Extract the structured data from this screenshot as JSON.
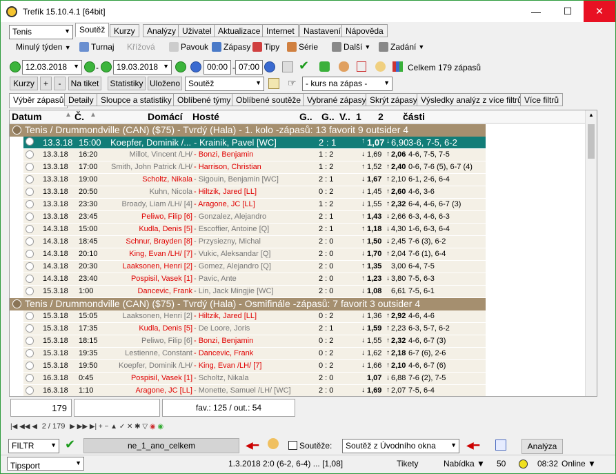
{
  "window": {
    "title": "Trefík 15.10.4.1 [64bit]",
    "min": "—",
    "max": "☐",
    "close": "✕"
  },
  "left_panel": {
    "sport": "Tenis",
    "period": "Minulý týden"
  },
  "menu_tabs": [
    "Soutěž",
    "Kurzy",
    "Analýzy",
    "Uživatel",
    "Aktualizace",
    "Internet",
    "Nastavení",
    "Nápověda"
  ],
  "toolbar": {
    "turnaj": "Turnaj",
    "krizova": "Křížová",
    "pavouk": "Pavouk",
    "zapasy": "Zápasy",
    "tipy": "Tipy",
    "serie": "Série",
    "dalsi": "Další",
    "zadani": "Zadání"
  },
  "filterbar": {
    "date_from": "12.03.2018",
    "date_to": "19.03.2018",
    "time_from": "00:00",
    "time_to": "07:00",
    "total": "Celkem 179 zápasů",
    "kurzy": "Kurzy",
    "plus": "+",
    "minus": "-",
    "na_tiket": "Na tiket",
    "statistiky": "Statistiky",
    "ulozeno": "Uloženo",
    "soutez": "Soutěž",
    "kurs": "- kurs na zápas -"
  },
  "subtabs": [
    "Výběr zápasů",
    "Detaily",
    "Sloupce a statistiky",
    "Oblíbené týmy",
    "Oblíbené soutěže",
    "Vybrané zápasy",
    "Skrýt zápasy",
    "Výsledky analýz z více filtrů",
    "Více filtrů"
  ],
  "columns": [
    "Datum",
    "Č.",
    "Domácí",
    "Hosté",
    "G..",
    "G..",
    "V..",
    "1",
    "2",
    "části"
  ],
  "groups": [
    {
      "title": "Tenis / Drummondville (CAN)  ($75) - Tvrdý (Hala) - 1. kolo -zápasů: 13      favorit 9  outsider 4",
      "rows": [
        {
          "date": "13.3.18",
          "time": "15:00",
          "home": "Koepfer, Dominik /...",
          "away": "- Krainik, Pavel [WC]",
          "score": "2 : 1",
          "o1": "1,07",
          "o2": "6,90",
          "sets": "3-6, 7-5, 6-2",
          "fav": "none",
          "o1b": true,
          "o2b": false,
          "a1": "↑",
          "a2": "↓",
          "sel": true
        },
        {
          "date": "13.3.18",
          "time": "16:20",
          "home": "Millot, Vincent /LH/",
          "away": "- Bonzi, Benjamin",
          "score": "1 : 2",
          "o1": "1,69",
          "o2": "2,06",
          "sets": "4-6, 7-5, 7-5",
          "fav": "away",
          "o1b": false,
          "o2b": true,
          "a1": "↓",
          "a2": "↑"
        },
        {
          "date": "13.3.18",
          "time": "17:00",
          "home": "Smith, John Patrick /LH/",
          "away": "- Harrison, Christian",
          "score": "1 : 2",
          "o1": "1,52",
          "o2": "2,40",
          "sets": "0-6, 7-6 (5), 6-7 (4)",
          "fav": "away",
          "o1b": false,
          "o2b": true,
          "a1": "↑",
          "a2": "↑"
        },
        {
          "date": "13.3.18",
          "time": "19:00",
          "home": "Scholtz, Nikala",
          "away": "- Sigouin, Benjamin [WC]",
          "score": "2 : 1",
          "o1": "1,67",
          "o2": "2,10",
          "sets": "6-1, 2-6, 6-4",
          "fav": "home",
          "o1b": true,
          "o2b": false,
          "a1": "↓",
          "a2": "↑"
        },
        {
          "date": "13.3.18",
          "time": "20:50",
          "home": "Kuhn, Nicola",
          "away": "- Hiltzik, Jared [LL]",
          "score": "0 : 2",
          "o1": "1,45",
          "o2": "2,60",
          "sets": "4-6, 3-6",
          "fav": "away",
          "o1b": false,
          "o2b": true,
          "a1": "↓",
          "a2": "↑"
        },
        {
          "date": "13.3.18",
          "time": "23:30",
          "home": "Broady, Liam /LH/ [4]",
          "away": "- Aragone, JC [LL]",
          "score": "1 : 2",
          "o1": "1,55",
          "o2": "2,32",
          "sets": "6-4, 4-6, 6-7 (3)",
          "fav": "away",
          "o1b": false,
          "o2b": true,
          "a1": "↓",
          "a2": "↑"
        },
        {
          "date": "13.3.18",
          "time": "23:45",
          "home": "Peliwo, Filip [6]",
          "away": "- Gonzalez, Alejandro",
          "score": "2 : 1",
          "o1": "1,43",
          "o2": "2,66",
          "sets": "6-3, 4-6, 6-3",
          "fav": "home",
          "o1b": true,
          "o2b": false,
          "a1": "↑",
          "a2": "↓"
        },
        {
          "date": "14.3.18",
          "time": "15:00",
          "home": "Kudla, Denis [5]",
          "away": "- Escoffier, Antoine [Q]",
          "score": "2 : 1",
          "o1": "1,18",
          "o2": "4,30",
          "sets": "1-6, 6-3, 6-4",
          "fav": "home",
          "o1b": true,
          "o2b": false,
          "a1": "↑",
          "a2": "↓"
        },
        {
          "date": "14.3.18",
          "time": "18:45",
          "home": "Schnur, Brayden [8]",
          "away": "- Przysiezny, Michal",
          "score": "2 : 0",
          "o1": "1,50",
          "o2": "2,45",
          "sets": "7-6 (3), 6-2",
          "fav": "home",
          "o1b": true,
          "o2b": false,
          "a1": "↑",
          "a2": "↓"
        },
        {
          "date": "14.3.18",
          "time": "20:10",
          "home": "King, Evan /LH/ [7]",
          "away": "- Vukic, Aleksandar [Q]",
          "score": "2 : 0",
          "o1": "1,70",
          "o2": "2,04",
          "sets": "7-6 (1), 6-4",
          "fav": "home",
          "o1b": true,
          "o2b": false,
          "a1": "↓",
          "a2": "↑"
        },
        {
          "date": "14.3.18",
          "time": "20:30",
          "home": "Laaksonen, Henri [2]",
          "away": "- Gomez, Alejandro [Q]",
          "score": "2 : 0",
          "o1": "1,35",
          "o2": "3,00",
          "sets": "6-4, 7-5",
          "fav": "home",
          "o1b": true,
          "o2b": false,
          "a1": "↑",
          "a2": ""
        },
        {
          "date": "14.3.18",
          "time": "23:40",
          "home": "Pospisil, Vasek [1]",
          "away": "- Pavic, Ante",
          "score": "2 : 0",
          "o1": "1,23",
          "o2": "3,80",
          "sets": "7-5, 6-3",
          "fav": "home",
          "o1b": true,
          "o2b": false,
          "a1": "↑",
          "a2": "↓"
        },
        {
          "date": "15.3.18",
          "time": "1:00",
          "home": "Dancevic, Frank",
          "away": "- Lin, Jack Mingjie [WC]",
          "score": "2 : 0",
          "o1": "1,08",
          "o2": "6,61",
          "sets": "7-5, 6-1",
          "fav": "home",
          "o1b": true,
          "o2b": false,
          "a1": "↓",
          "a2": ""
        }
      ]
    },
    {
      "title": "Tenis / Drummondville (CAN)  ($75) - Tvrdý (Hala) - Osmifinále -zápasů: 7       favorit 3  outsider 4",
      "rows": [
        {
          "date": "15.3.18",
          "time": "15:05",
          "home": "Laaksonen, Henri [2]",
          "away": "- Hiltzik, Jared [LL]",
          "score": "0 : 2",
          "o1": "1,36",
          "o2": "2,92",
          "sets": "4-6, 4-6",
          "fav": "away",
          "o1b": false,
          "o2b": true,
          "a1": "↓",
          "a2": "↑"
        },
        {
          "date": "15.3.18",
          "time": "17:35",
          "home": "Kudla, Denis [5]",
          "away": "- De Loore, Joris",
          "score": "2 : 1",
          "o1": "1,59",
          "o2": "2,23",
          "sets": "6-3, 5-7, 6-2",
          "fav": "home",
          "o1b": true,
          "o2b": false,
          "a1": "↓",
          "a2": "↑"
        },
        {
          "date": "15.3.18",
          "time": "18:15",
          "home": "Peliwo, Filip [6]",
          "away": "- Bonzi, Benjamin",
          "score": "0 : 2",
          "o1": "1,55",
          "o2": "2,32",
          "sets": "4-6, 6-7 (3)",
          "fav": "away",
          "o1b": false,
          "o2b": true,
          "a1": "↓",
          "a2": "↑"
        },
        {
          "date": "15.3.18",
          "time": "19:35",
          "home": "Lestienne, Constant",
          "away": "- Dancevic, Frank",
          "score": "0 : 2",
          "o1": "1,62",
          "o2": "2,18",
          "sets": "6-7 (6), 2-6",
          "fav": "away",
          "o1b": false,
          "o2b": true,
          "a1": "↓",
          "a2": "↑"
        },
        {
          "date": "15.3.18",
          "time": "19:50",
          "home": "Koepfer, Dominik /LH/",
          "away": "- King, Evan /LH/ [7]",
          "score": "0 : 2",
          "o1": "1,66",
          "o2": "2,10",
          "sets": "4-6, 6-7 (6)",
          "fav": "away",
          "o1b": false,
          "o2b": true,
          "a1": "↓",
          "a2": "↑"
        },
        {
          "date": "16.3.18",
          "time": "0:45",
          "home": "Pospisil, Vasek [1]",
          "away": "- Scholtz, Nikala",
          "score": "2 : 0",
          "o1": "1,07",
          "o2": "6,88",
          "sets": "7-6 (2), 7-5",
          "fav": "home",
          "o1b": true,
          "o2b": false,
          "a1": "",
          "a2": "↓"
        },
        {
          "date": "16.3.18",
          "time": "1:10",
          "home": "Aragone, JC [LL]",
          "away": "- Monette, Samuel /LH/ [WC]",
          "score": "2 : 0",
          "o1": "1,69",
          "o2": "2,07",
          "sets": "7-5, 6-4",
          "fav": "home",
          "o1b": true,
          "o2b": false,
          "a1": "↓",
          "a2": "↑"
        }
      ]
    }
  ],
  "footer": {
    "count": "179",
    "favout": "fav.: 125 / out.: 54",
    "pager": "2 / 179"
  },
  "filter": {
    "label": "FILTR",
    "name": "ne_1_ano_celkem",
    "soutez_label": "Soutěže:",
    "soutez_value": "Soutěž z Úvodního okna",
    "analyza": "Analýza"
  },
  "status": {
    "provider": "Tipsport",
    "match": "1.3.2018 2:0 (6-2, 6-4) ... [1,08]",
    "tikety": "Tikety",
    "nabidka": "Nabídka ▼",
    "num": "50",
    "time": "08:32",
    "online": "Online ▼"
  },
  "colors": {
    "green_border": "#2a9a3a",
    "group_bg": "#a58f6f",
    "selected_row": "#127d78",
    "favorite_red": "#e00000",
    "row_bg": "#f4f0e6"
  }
}
